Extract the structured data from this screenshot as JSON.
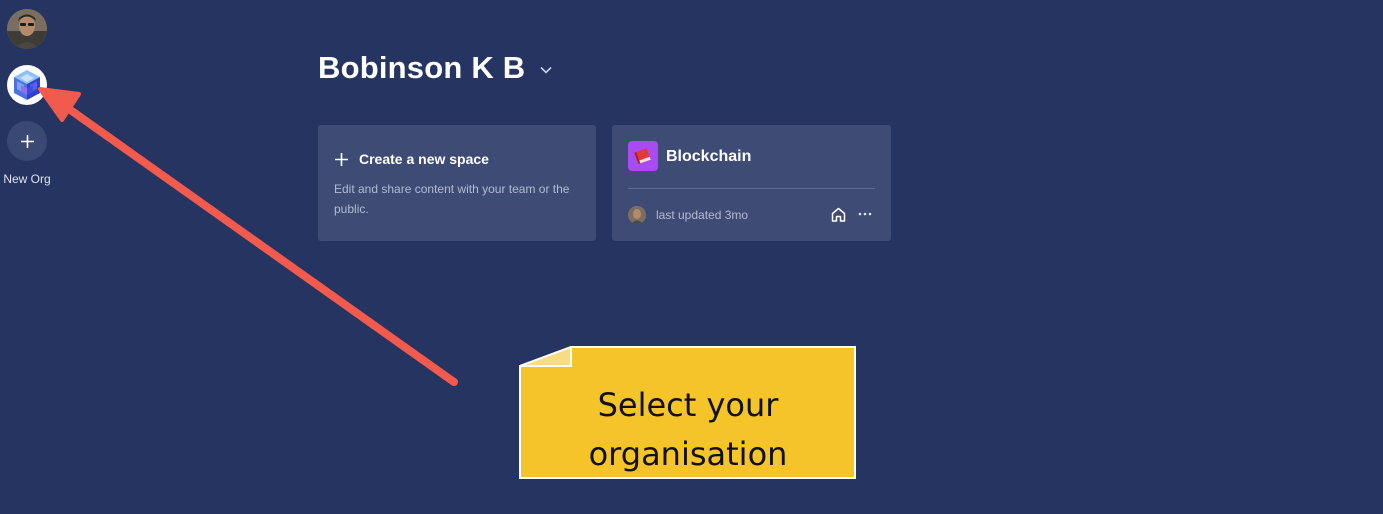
{
  "sidebar": {
    "user_avatar_alt": "user-avatar",
    "org_icon": "cube-logo-icon",
    "new_org_label": "New Org"
  },
  "header": {
    "title": "Bobinson K B"
  },
  "create_card": {
    "label": "Create a new space",
    "description": "Edit and share content with your team or the public."
  },
  "spaces": [
    {
      "name": "Blockchain",
      "icon": "book-icon",
      "updated": "last updated 3mo"
    }
  ],
  "annotation": {
    "text": "Select your organisation"
  },
  "colors": {
    "background": "#253461",
    "card": "#3e4b75",
    "note": "#f5c428",
    "arrow": "#f25a4e",
    "space_icon": "#a84bf3"
  }
}
